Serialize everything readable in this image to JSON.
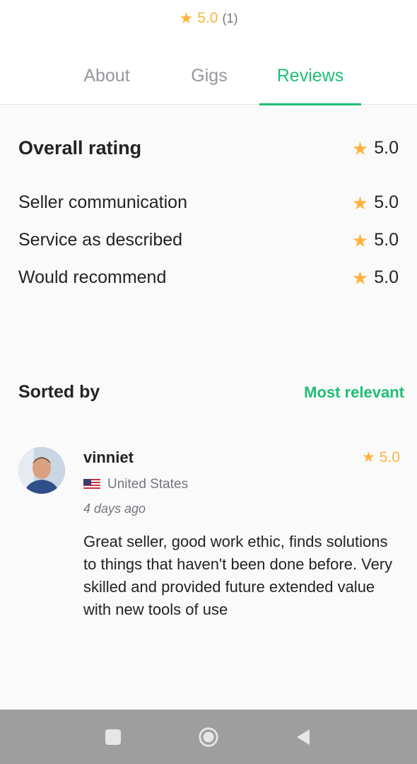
{
  "header": {
    "rating": "5.0",
    "rating_count": "(1)",
    "tabs": [
      {
        "label": "About",
        "active": false
      },
      {
        "label": "Gigs",
        "active": false
      },
      {
        "label": "Reviews",
        "active": true
      }
    ]
  },
  "ratings": {
    "overall": {
      "label": "Overall rating",
      "value": "5.0"
    },
    "items": [
      {
        "label": "Seller communication",
        "value": "5.0"
      },
      {
        "label": "Service as described",
        "value": "5.0"
      },
      {
        "label": "Would recommend",
        "value": "5.0"
      }
    ]
  },
  "sort": {
    "label": "Sorted by",
    "value": "Most relevant"
  },
  "reviews": [
    {
      "user": "vinniet",
      "rating": "5.0",
      "country": "United States",
      "time": "4 days ago",
      "text": "Great seller, good work ethic, finds solutions to things that haven't been done before. Very skilled and provided future extended value with new tools of use"
    }
  ],
  "colors": {
    "accent": "#1dbf73",
    "star": "#ffb33e",
    "navbar": "#9e9e9e"
  },
  "icons": {
    "star": "star-icon",
    "flag": "us-flag-icon",
    "nav": [
      "square-recents-icon",
      "circle-home-icon",
      "triangle-back-icon"
    ]
  }
}
